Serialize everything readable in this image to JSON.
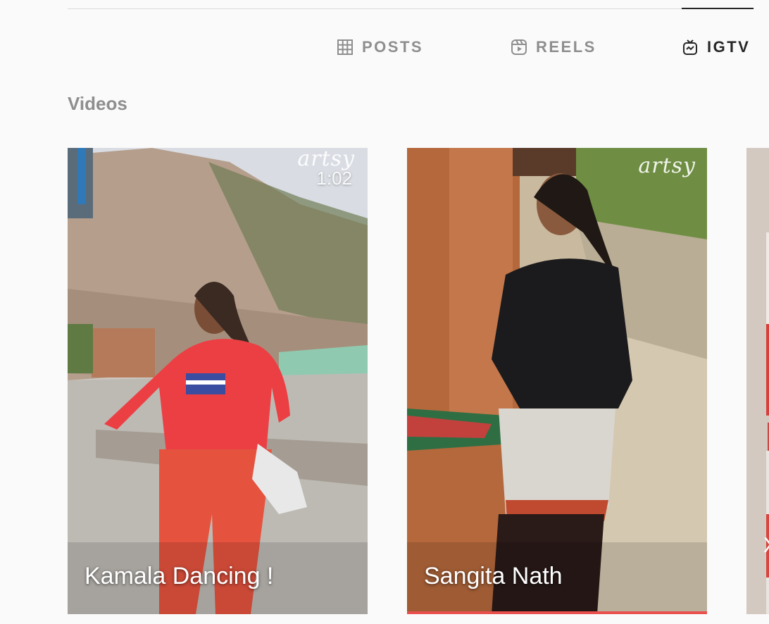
{
  "tabs": [
    {
      "label": "POSTS",
      "icon": "grid-icon",
      "active": false
    },
    {
      "label": "REELS",
      "icon": "reels-icon",
      "active": false
    },
    {
      "label": "IGTV",
      "icon": "igtv-icon",
      "active": true
    }
  ],
  "section": {
    "title": "Videos"
  },
  "videos": [
    {
      "title": "Kamala Dancing !",
      "duration": "1:02",
      "watermark": "artsy"
    },
    {
      "title": "Sangita Nath",
      "duration": "",
      "watermark": "artsy"
    },
    {
      "title": "",
      "partial_text": "X"
    }
  ],
  "colors": {
    "background": "#fafafa",
    "tab_inactive": "#8e8e8e",
    "tab_active": "#262626",
    "divider": "#dbdbdb"
  }
}
